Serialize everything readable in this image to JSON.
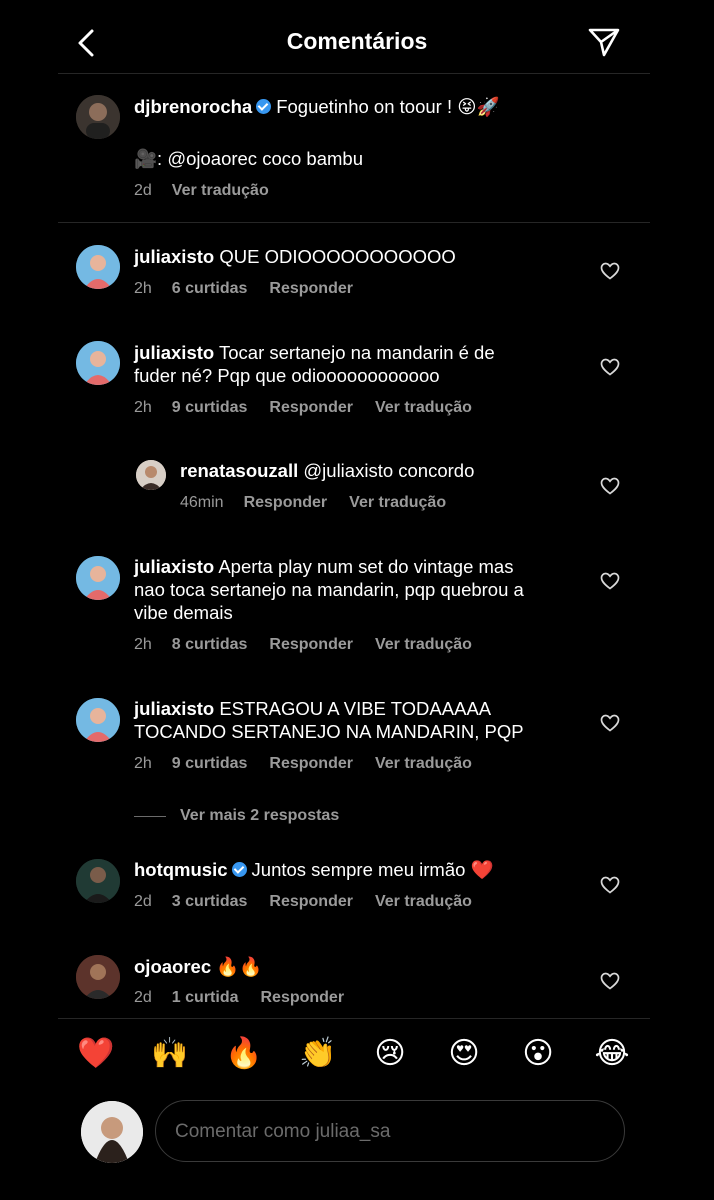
{
  "header": {
    "title": "Comentários"
  },
  "caption": {
    "username": "djbrenorocha",
    "text": "Foguetinho on toour ! 😝🚀",
    "line2": "🎥: @ojoaorec coco bambu",
    "time": "2d",
    "translate": "Ver tradução"
  },
  "comments": [
    {
      "username": "juliaxisto",
      "text": "QUE ODIOOOOOOOOOOO",
      "time": "2h",
      "likes": "6 curtidas",
      "reply": "Responder"
    },
    {
      "username": "juliaxisto",
      "text": "Tocar sertanejo na mandarin é de",
      "text2": "fuder né? Pqp que odioooooooooooo",
      "time": "2h",
      "likes": "9 curtidas",
      "reply": "Responder",
      "translate": "Ver tradução"
    },
    {
      "username": "renatasouzall",
      "text": "@juliaxisto concordo",
      "time": "46min",
      "reply": "Responder",
      "translate": "Ver tradução"
    },
    {
      "username": "juliaxisto",
      "text": "Aperta play num set do vintage mas",
      "text2": "nao toca sertanejo na mandarin, pqp quebrou a",
      "text3": "vibe demais",
      "time": "2h",
      "likes": "8 curtidas",
      "reply": "Responder",
      "translate": "Ver tradução"
    },
    {
      "username": "juliaxisto",
      "text": "ESTRAGOU A VIBE TODAAAAA",
      "text2": "TOCANDO SERTANEJO NA MANDARIN, PQP",
      "time": "2h",
      "likes": "9 curtidas",
      "reply": "Responder",
      "translate": "Ver tradução"
    },
    {
      "username": "hotqmusic",
      "text": "Juntos sempre meu irmão ❤️",
      "time": "2d",
      "likes": "3 curtidas",
      "reply": "Responder",
      "translate": "Ver tradução"
    },
    {
      "username": "ojoaorec",
      "text": "🔥🔥",
      "time": "2d",
      "likes": "1 curtida",
      "reply": "Responder"
    }
  ],
  "more_replies": "Ver mais 2 respostas",
  "reactions": [
    "❤️",
    "🙌",
    "🔥",
    "👏",
    "😢",
    "😍",
    "😮",
    "😂"
  ],
  "composer": {
    "placeholder": "Comentar como juliaa_sa"
  }
}
